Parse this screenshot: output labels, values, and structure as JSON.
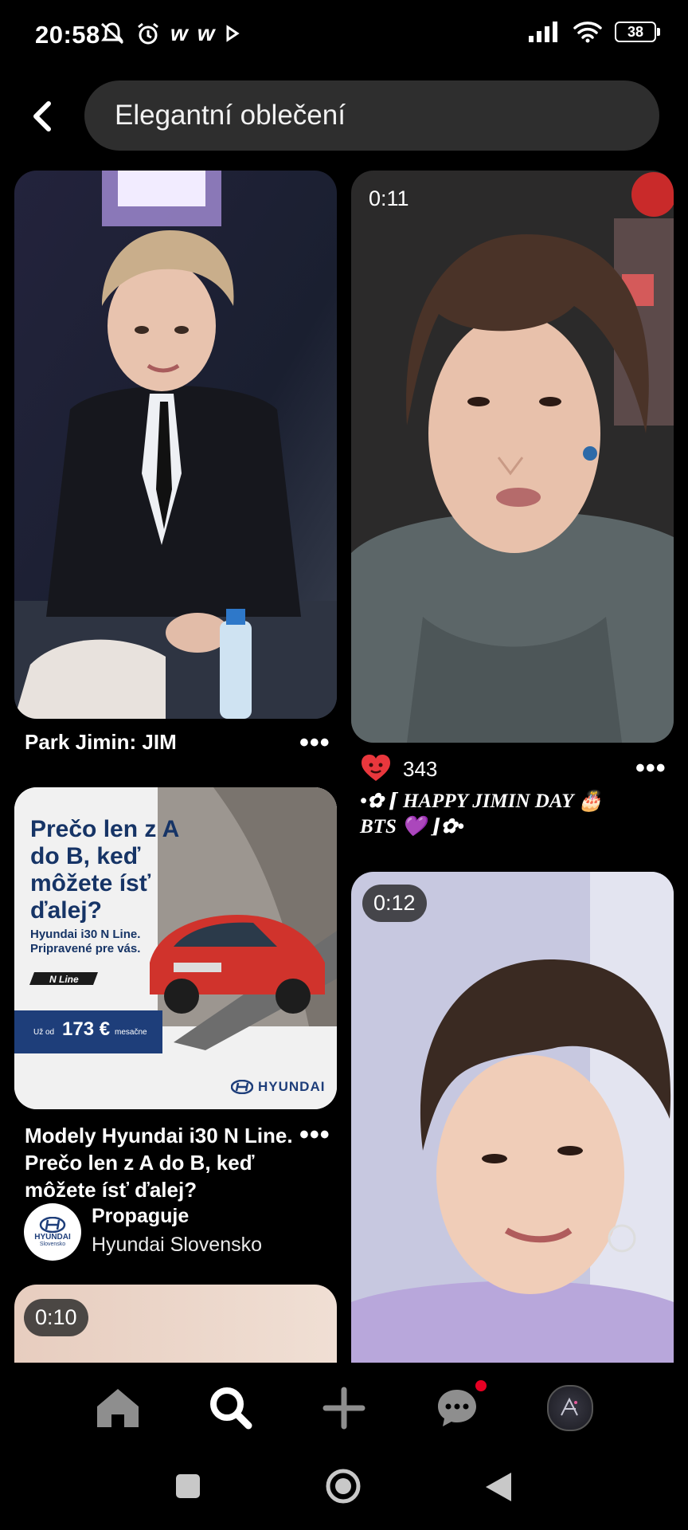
{
  "status_bar": {
    "time": "20:58",
    "battery": "38",
    "left_icons": [
      "mute-bell-icon",
      "alarm-icon",
      "w-app-icon",
      "w-app-icon",
      "play-icon"
    ],
    "right_icons": [
      "signal-icon",
      "wifi-icon",
      "battery-icon"
    ]
  },
  "header": {
    "back_icon": "back-arrow-icon",
    "search_query": "Elegantní oblečení"
  },
  "pins": {
    "pin1": {
      "title": "Park Jimin: JIM",
      "more": "•••"
    },
    "pin2": {
      "duration": "0:11",
      "reaction_icon": "heart-icon",
      "reactions": "343",
      "more": "•••",
      "title": "•✿ ⌈ HAPPY JIMIN DAY 🎂 BTS 💜 ⌋✿•"
    },
    "pin3": {
      "ad_headline": "Prečo len z A do B, keď môžete ísť ďalej?",
      "ad_sub": "Hyundai i30 N Line. Pripravené pre vás.",
      "ad_nline": "N Line",
      "ad_price_prefix": "Už od",
      "ad_price": "173 €",
      "ad_price_suffix": "mesačne",
      "ad_brand": "HYUNDAI",
      "title": "Modely Hyundai i30 N Line. Prečo len z A do B, keď môžete ísť ďalej?",
      "more": "•••",
      "promo_label": "Propaguje",
      "promo_name": "Hyundai Slovensko",
      "avatar_brand": "HYUNDAI",
      "avatar_sub": "Slovensko"
    },
    "pin4": {
      "duration": "0:12"
    },
    "pin5": {
      "duration": "0:10"
    }
  },
  "nav": {
    "items": [
      "home-icon",
      "search-icon",
      "create-icon",
      "messages-icon",
      "profile-avatar"
    ],
    "active": "search-icon",
    "messages_notification_color": "#e60023"
  },
  "system_nav": [
    "recents-icon",
    "home-circle-icon",
    "back-triangle-icon"
  ]
}
